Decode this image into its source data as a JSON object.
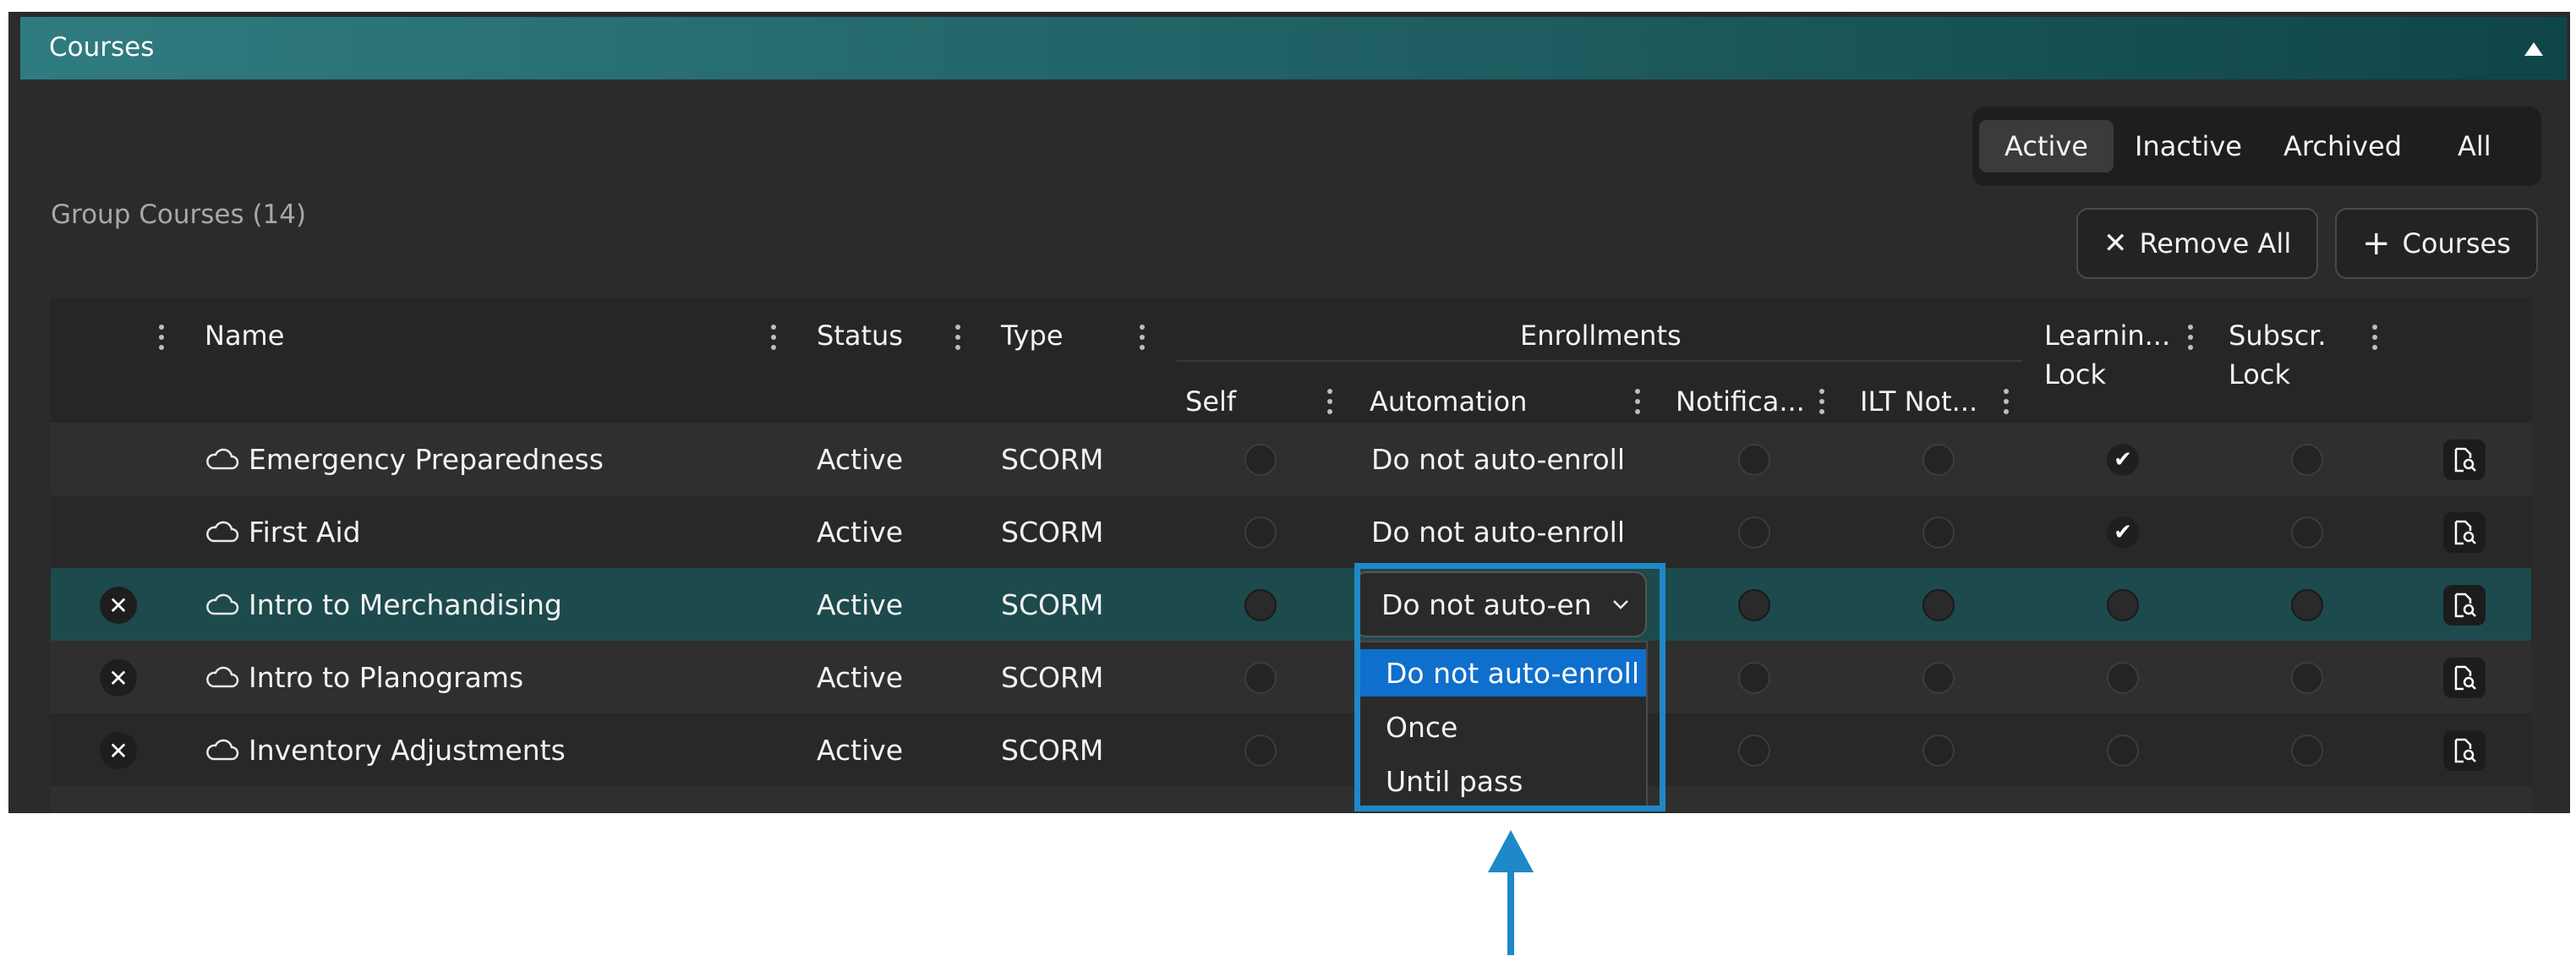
{
  "panel": {
    "title": "Courses",
    "collapse_icon": "caret-up-icon"
  },
  "filters": {
    "items": [
      "Active",
      "Inactive",
      "Archived",
      "All"
    ],
    "selected": "Active"
  },
  "group_courses_label": "Group Courses (14)",
  "actions": {
    "remove_all": "Remove All",
    "add_courses": "Courses"
  },
  "columns": {
    "name": "Name",
    "status": "Status",
    "type": "Type",
    "enrollments": "Enrollments",
    "self": "Self",
    "automation": "Automation",
    "notifications": "Notifica...",
    "ilt_notifications": "ILT Not...",
    "learning_lock_1": "Learnin...",
    "learning_lock_2": "Lock",
    "subscr_lock_1": "Subscr.",
    "subscr_lock_2": "Lock"
  },
  "rows": [
    {
      "name": "Emergency Preparedness",
      "status": "Active",
      "type": "SCORM",
      "automation": "Do not auto-enroll",
      "learning_lock": true,
      "removable": false
    },
    {
      "name": "First Aid",
      "status": "Active",
      "type": "SCORM",
      "automation": "Do not auto-enroll",
      "learning_lock": true,
      "removable": false
    },
    {
      "name": "Intro to Merchandising",
      "status": "Active",
      "type": "SCORM",
      "automation": "Do not auto-enr",
      "learning_lock": false,
      "removable": true
    },
    {
      "name": "Intro to Planograms",
      "status": "Active",
      "type": "SCORM",
      "automation": "",
      "learning_lock": false,
      "removable": true
    },
    {
      "name": "Inventory Adjustments",
      "status": "Active",
      "type": "SCORM",
      "automation": "",
      "learning_lock": false,
      "removable": true
    }
  ],
  "automation_dropdown": {
    "current_value": "Do not auto-enr",
    "options": [
      "Do not auto-enroll",
      "Once",
      "Until pass"
    ],
    "selected_option": "Do not auto-enroll"
  },
  "colors": {
    "accent_header": "#2f7c80",
    "selected_row": "#1d4a4c",
    "highlight_box": "#1e88c8",
    "selected_option": "#0f6fcc"
  }
}
